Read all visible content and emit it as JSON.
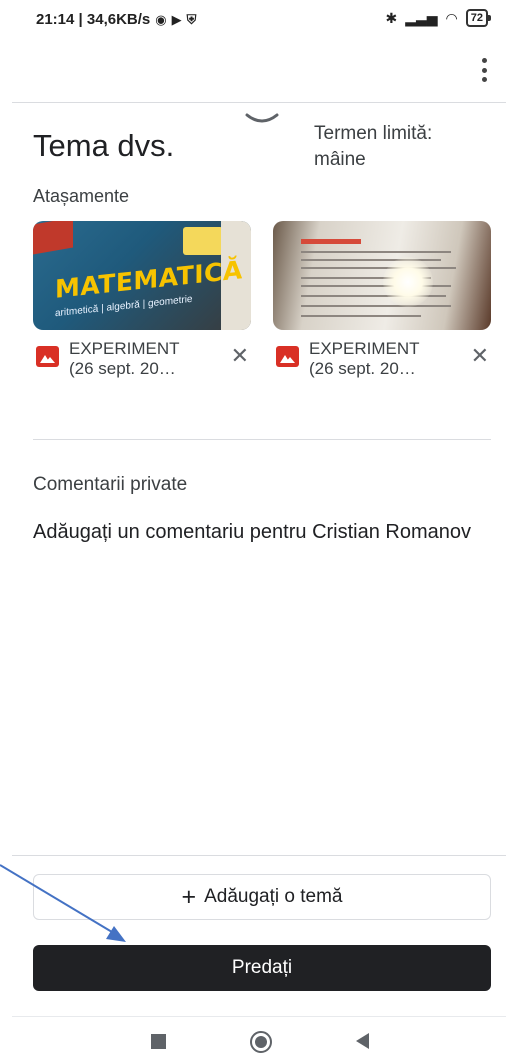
{
  "status_bar": {
    "time_speed": "21:14 | 34,6KB/s",
    "battery": "72"
  },
  "assignment": {
    "title": "Tema dvs.",
    "due_label": "Termen limită:",
    "due_value": "mâine"
  },
  "attachments": {
    "label": "Atașamente",
    "items": [
      {
        "name_line1": "EXPERIMENT",
        "name_line2": "(26 sept. 20…",
        "thumb_title": "MATEMATICĂ",
        "thumb_subtitle": "aritmetică | algebră | geometrie"
      },
      {
        "name_line1": "EXPERIMENT",
        "name_line2": "(26 sept. 20…"
      }
    ]
  },
  "private_comments": {
    "label": "Comentarii private",
    "placeholder": "Adăugați un comentariu pentru Cristian Romanov"
  },
  "actions": {
    "add_label": "Adăugați o temă",
    "submit_label": "Predați"
  },
  "colors": {
    "submit_bg": "#202124",
    "attachment_icon": "#d93025",
    "annotation_arrow": "#4472c4"
  }
}
